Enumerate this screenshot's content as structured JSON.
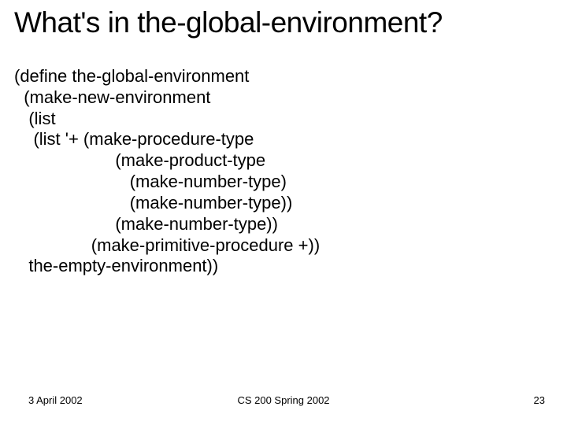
{
  "title": "What's in the-global-environment?",
  "code": {
    "l1": "(define the-global-environment",
    "l2": "  (make-new-environment",
    "l3": "   (list",
    "l4": "    (list '+ (make-procedure-type",
    "l5": "                     (make-product-type",
    "l6": "                        (make-number-type)",
    "l7": "                        (make-number-type))",
    "l8": "                     (make-number-type))",
    "l9": "                (make-primitive-procedure +))",
    "l10": "   the-empty-environment))"
  },
  "footer": {
    "date": "3 April 2002",
    "course": "CS 200 Spring 2002",
    "page": "23"
  }
}
